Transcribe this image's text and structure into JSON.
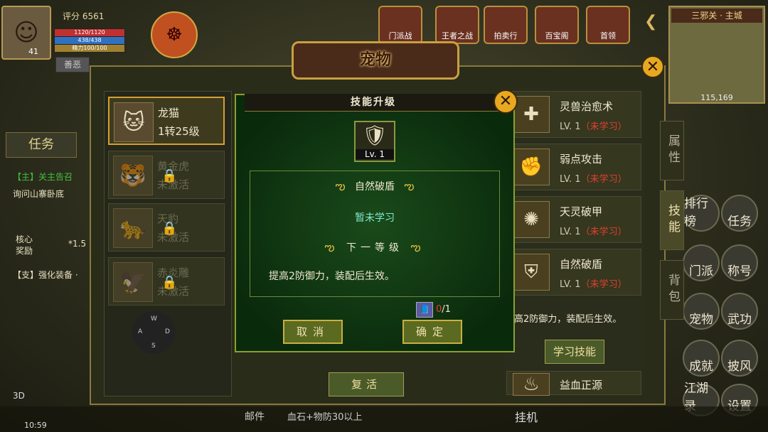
{
  "hud": {
    "score": "评分 6561",
    "hp_bar": "1120/1120",
    "mp_bar": "438/438",
    "exp_bar": "精力100/100",
    "avatar_level": "41",
    "shan_badge": "善恶",
    "top_icons": [
      "门派战",
      "王者之战",
      "拍卖行",
      "百宝阁",
      "首领"
    ]
  },
  "minimap": {
    "title": "三邪关 · 主城",
    "coords": "115,169"
  },
  "quest": {
    "task_button": "任务",
    "lines": [
      "【主】关主告召",
      "询问山寨卧底",
      "核心",
      "奖励",
      "*1.5",
      "【支】强化装备 ·"
    ]
  },
  "right_menu": [
    "排行榜",
    "任务",
    "门派",
    "称号",
    "宠物",
    "武功",
    "成就",
    "披风",
    "江湖录",
    "设置"
  ],
  "bottom": {
    "time": "10:59",
    "mail": "邮件",
    "chat": "血石+物防30以上",
    "afk": "挂机",
    "view": "3D"
  },
  "pet_window": {
    "title": "宠物",
    "pets": [
      {
        "name": "龙猫",
        "level": "1转25级",
        "icon": "cat-icon",
        "locked": false
      },
      {
        "name": "黄金虎",
        "level": "未激活",
        "icon": "tiger-icon",
        "locked": true
      },
      {
        "name": "天豹",
        "level": "未激活",
        "icon": "leopard-icon",
        "locked": true
      },
      {
        "name": "赤炎雕",
        "level": "未激活",
        "icon": "eagle-icon",
        "locked": true
      }
    ],
    "dpad": {
      "up": "W",
      "left": "A",
      "right": "D",
      "down": "S"
    },
    "revive_button": "复活",
    "tabs": [
      "属性",
      "技能",
      "背包"
    ],
    "active_tab": "技能",
    "skills": [
      {
        "name": "灵兽治愈术",
        "level": "LV. 1",
        "state": "（未学习）"
      },
      {
        "name": "弱点攻击",
        "level": "LV. 1",
        "state": "（未学习）"
      },
      {
        "name": "天灵破甲",
        "level": "LV. 1",
        "state": "（未学习）"
      },
      {
        "name": "自然破盾",
        "level": "LV. 1",
        "state": "（未学习）"
      },
      {
        "name": "益血正源",
        "level": "",
        "state": ""
      }
    ],
    "selected_skill_desc": "提高2防御力，装配后生效。",
    "learn_button": "学习技能"
  },
  "dialog": {
    "title": "技能升级",
    "skill_level": "Lv. 1",
    "current_name": "自然破盾",
    "current_status": "暂未学习",
    "next_heading": "下一等级",
    "next_desc": "提高2防御力，装配后生效。",
    "book_have": "0",
    "book_need": "/1",
    "cancel": "取消",
    "confirm": "确定"
  },
  "colors": {
    "dialog_bg": "#0f3a14",
    "gold_border": "#c8a040",
    "unlearned_red": "#e04030"
  }
}
